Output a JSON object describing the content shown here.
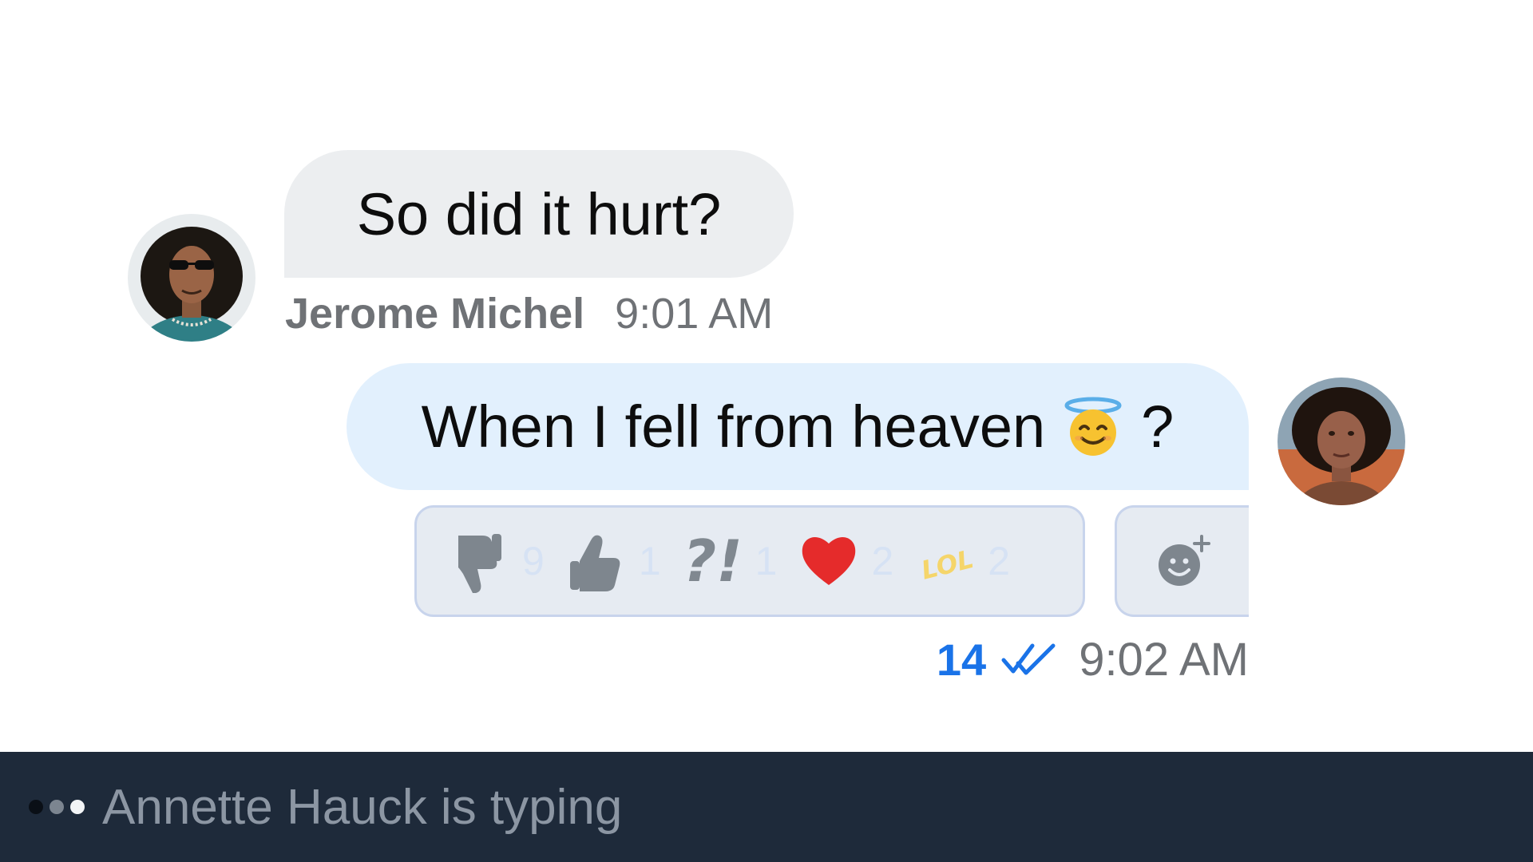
{
  "incoming_message": {
    "text": "So did it hurt?",
    "sender_name": "Jerome Michel",
    "time": "9:01 AM"
  },
  "outgoing_message": {
    "text": "When I fell from heaven",
    "emoji": "smiling-face-with-halo",
    "trailing_text": "?",
    "read_count": "14",
    "time": "9:02 AM"
  },
  "reactions": [
    {
      "icon": "thumbs-down-icon",
      "count": "9"
    },
    {
      "icon": "thumbs-up-icon",
      "count": "1"
    },
    {
      "icon": "interrobang",
      "label": "?!",
      "count": "1"
    },
    {
      "icon": "heart-icon",
      "count": "2"
    },
    {
      "icon": "lol-icon",
      "label": "LOL",
      "count": "2"
    }
  ],
  "add_reaction_icon": "add-emoji-icon",
  "typing_indicator": {
    "text": "Annette Hauck is typing"
  },
  "colors": {
    "incoming_bubble": "#eceef0",
    "outgoing_bubble": "#e2f0fd",
    "accent": "#1a73e8",
    "typing_bar": "#1e2a3a"
  }
}
